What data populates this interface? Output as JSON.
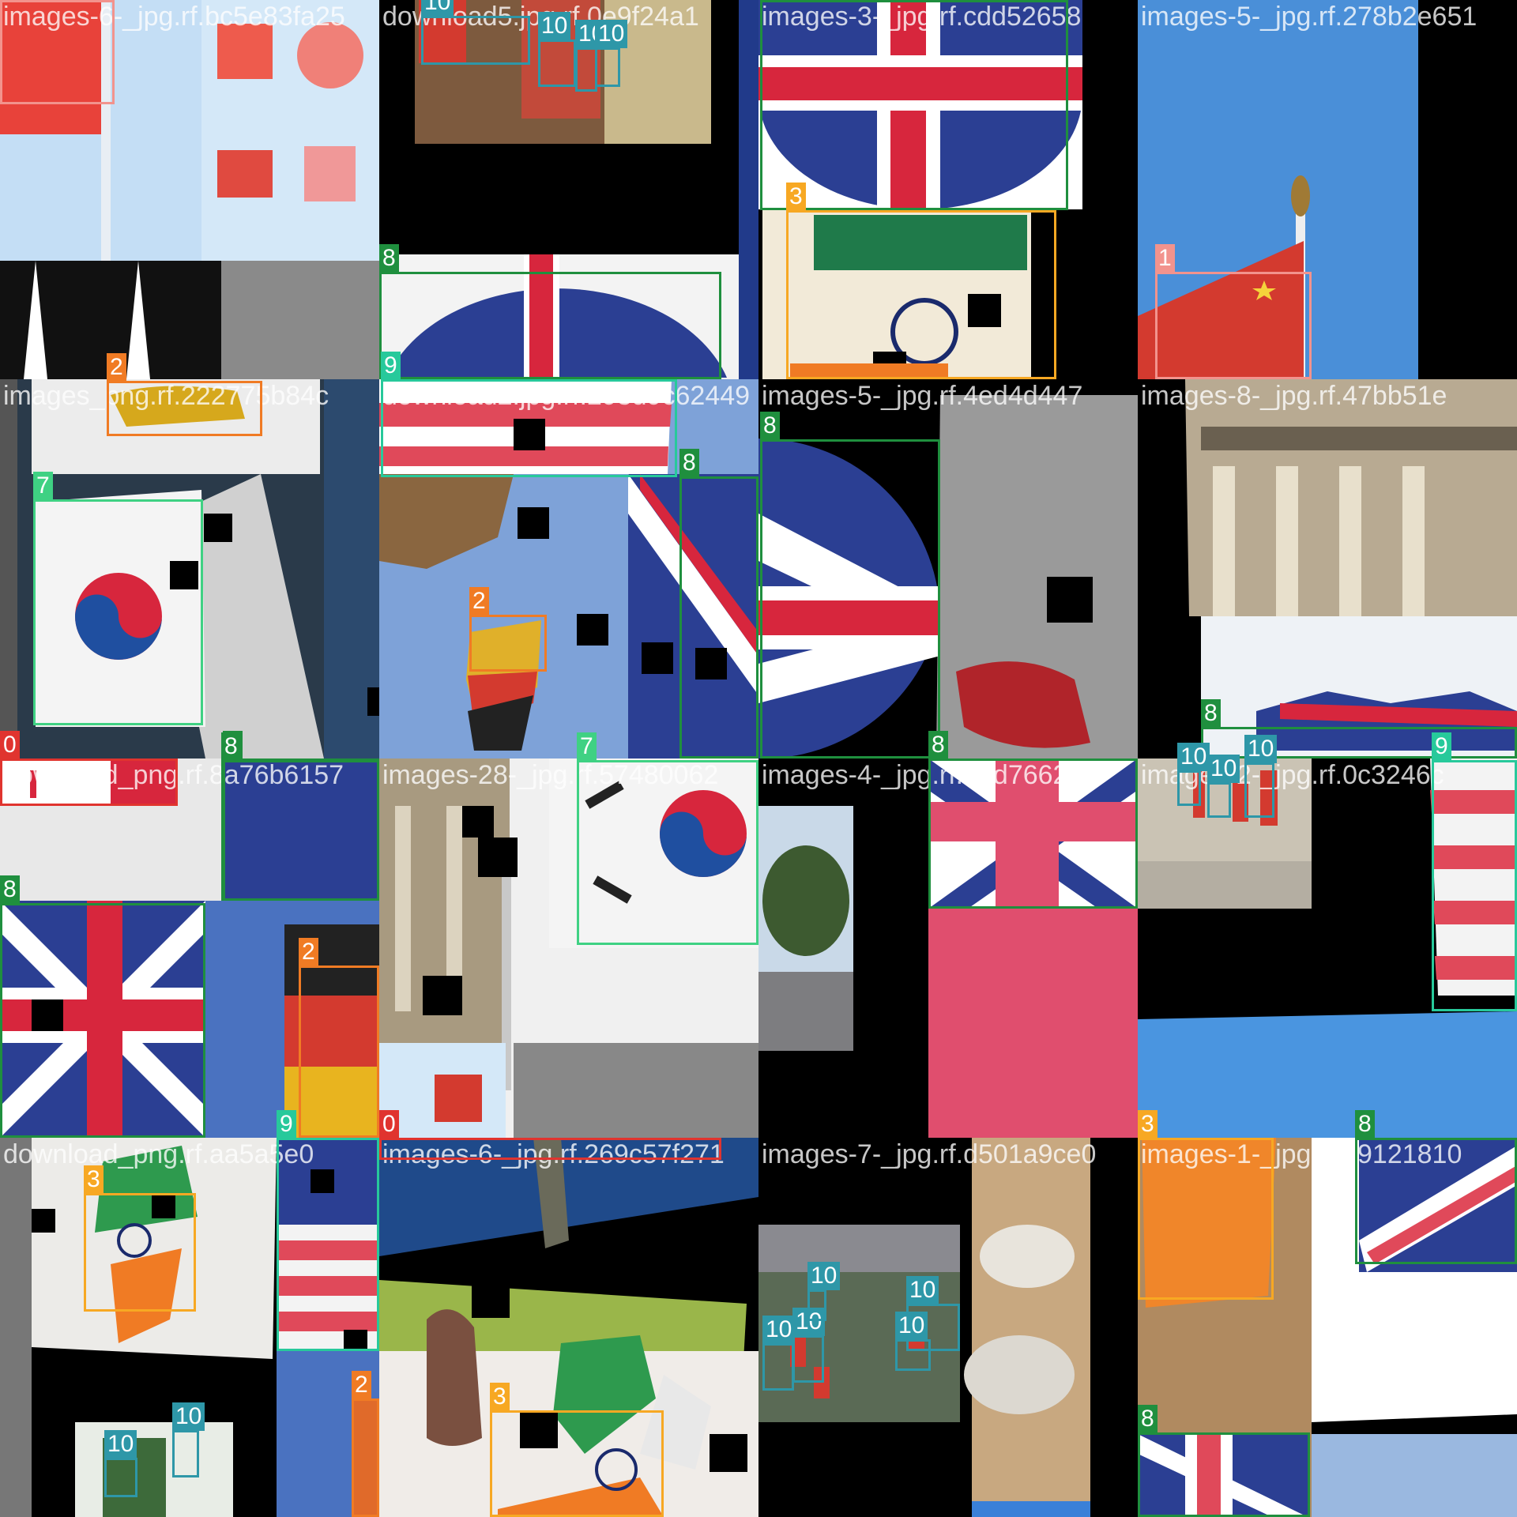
{
  "colors": {
    "0": "#e0342f",
    "1": "#f2938d",
    "2": "#f07b24",
    "3": "#f7a823",
    "7": "#3fd183",
    "8": "#1f8f3e",
    "9": "#27c99b",
    "10": "#2e97a8"
  },
  "tiles": [
    {
      "title": "images-6-_jpg.rf.bc5e83fa25",
      "content": "china-flags"
    },
    {
      "title": "download5.jpg.rf.0e9f24a1",
      "content": "street-flags"
    },
    {
      "title": "images-3-_jpg.rf.cdd52658",
      "content": "uk-circle"
    },
    {
      "title": "images-5-_jpg.rf.278b2e651",
      "content": "china-pole"
    },
    {
      "title": "images_png.rf.222775b84c",
      "content": "korea-building"
    },
    {
      "title": "download2.jpg.rf.293d9c62449",
      "content": "germany-sky"
    },
    {
      "title": "images-5-_jpg.rf.4ed4d447",
      "content": "uk-circle-large"
    },
    {
      "title": "images-8-_jpg.rf.47bb51e",
      "content": "parliament"
    },
    {
      "title": "download_png.rf.8a76b6157",
      "content": "uk-germany"
    },
    {
      "title": "images-28-_jpg.rf.57480062",
      "content": "korea-building2"
    },
    {
      "title": "images-4-_jpg.rf.d1d7662d4",
      "content": "uk-pink"
    },
    {
      "title": "images-2-_jpg.rf.0c3246c",
      "content": "street-us"
    },
    {
      "title": "download_png.rf.aa5a5e0",
      "content": "india-us"
    },
    {
      "title": "images-6-_jpg.rf.269c57f271",
      "content": "india-upside"
    },
    {
      "title": "images-7-_jpg.rf.d501a9ce0",
      "content": "street-flags2"
    },
    {
      "title": "images-1-_jpg.rf.49121810",
      "content": "uk-orange"
    }
  ],
  "boxes": [
    {
      "tile": 0,
      "label": "1"
    },
    {
      "tile": 1,
      "label": "10"
    },
    {
      "tile": 1,
      "label": "10"
    },
    {
      "tile": 1,
      "label": "10"
    },
    {
      "tile": 1,
      "label": "10"
    },
    {
      "tile": 1,
      "label": "8"
    },
    {
      "tile": 1,
      "label": "2"
    },
    {
      "tile": 2,
      "label": "8"
    },
    {
      "tile": 2,
      "label": "3"
    },
    {
      "tile": 3,
      "label": "1"
    },
    {
      "tile": 4,
      "label": "9"
    },
    {
      "tile": 4,
      "label": "7"
    },
    {
      "tile": 4,
      "label": "0"
    },
    {
      "tile": 5,
      "label": "8"
    },
    {
      "tile": 5,
      "label": "2"
    },
    {
      "tile": 5,
      "label": "8"
    },
    {
      "tile": 6,
      "label": "8"
    },
    {
      "tile": 7,
      "label": "8"
    },
    {
      "tile": 8,
      "label": "8"
    },
    {
      "tile": 8,
      "label": "2"
    },
    {
      "tile": 8,
      "label": "8"
    },
    {
      "tile": 9,
      "label": "7"
    },
    {
      "tile": 9,
      "label": "0"
    },
    {
      "tile": 10,
      "label": "8"
    },
    {
      "tile": 11,
      "label": "10"
    },
    {
      "tile": 11,
      "label": "10"
    },
    {
      "tile": 11,
      "label": "10"
    },
    {
      "tile": 11,
      "label": "9"
    },
    {
      "tile": 12,
      "label": "3"
    },
    {
      "tile": 12,
      "label": "9"
    },
    {
      "tile": 12,
      "label": "10"
    },
    {
      "tile": 12,
      "label": "10"
    },
    {
      "tile": 12,
      "label": "2"
    },
    {
      "tile": 13,
      "label": "3"
    },
    {
      "tile": 14,
      "label": "10"
    },
    {
      "tile": 14,
      "label": "10"
    },
    {
      "tile": 14,
      "label": "10"
    },
    {
      "tile": 14,
      "label": "10"
    },
    {
      "tile": 14,
      "label": "10"
    },
    {
      "tile": 15,
      "label": "3"
    },
    {
      "tile": 15,
      "label": "8"
    },
    {
      "tile": 15,
      "label": "8"
    }
  ]
}
